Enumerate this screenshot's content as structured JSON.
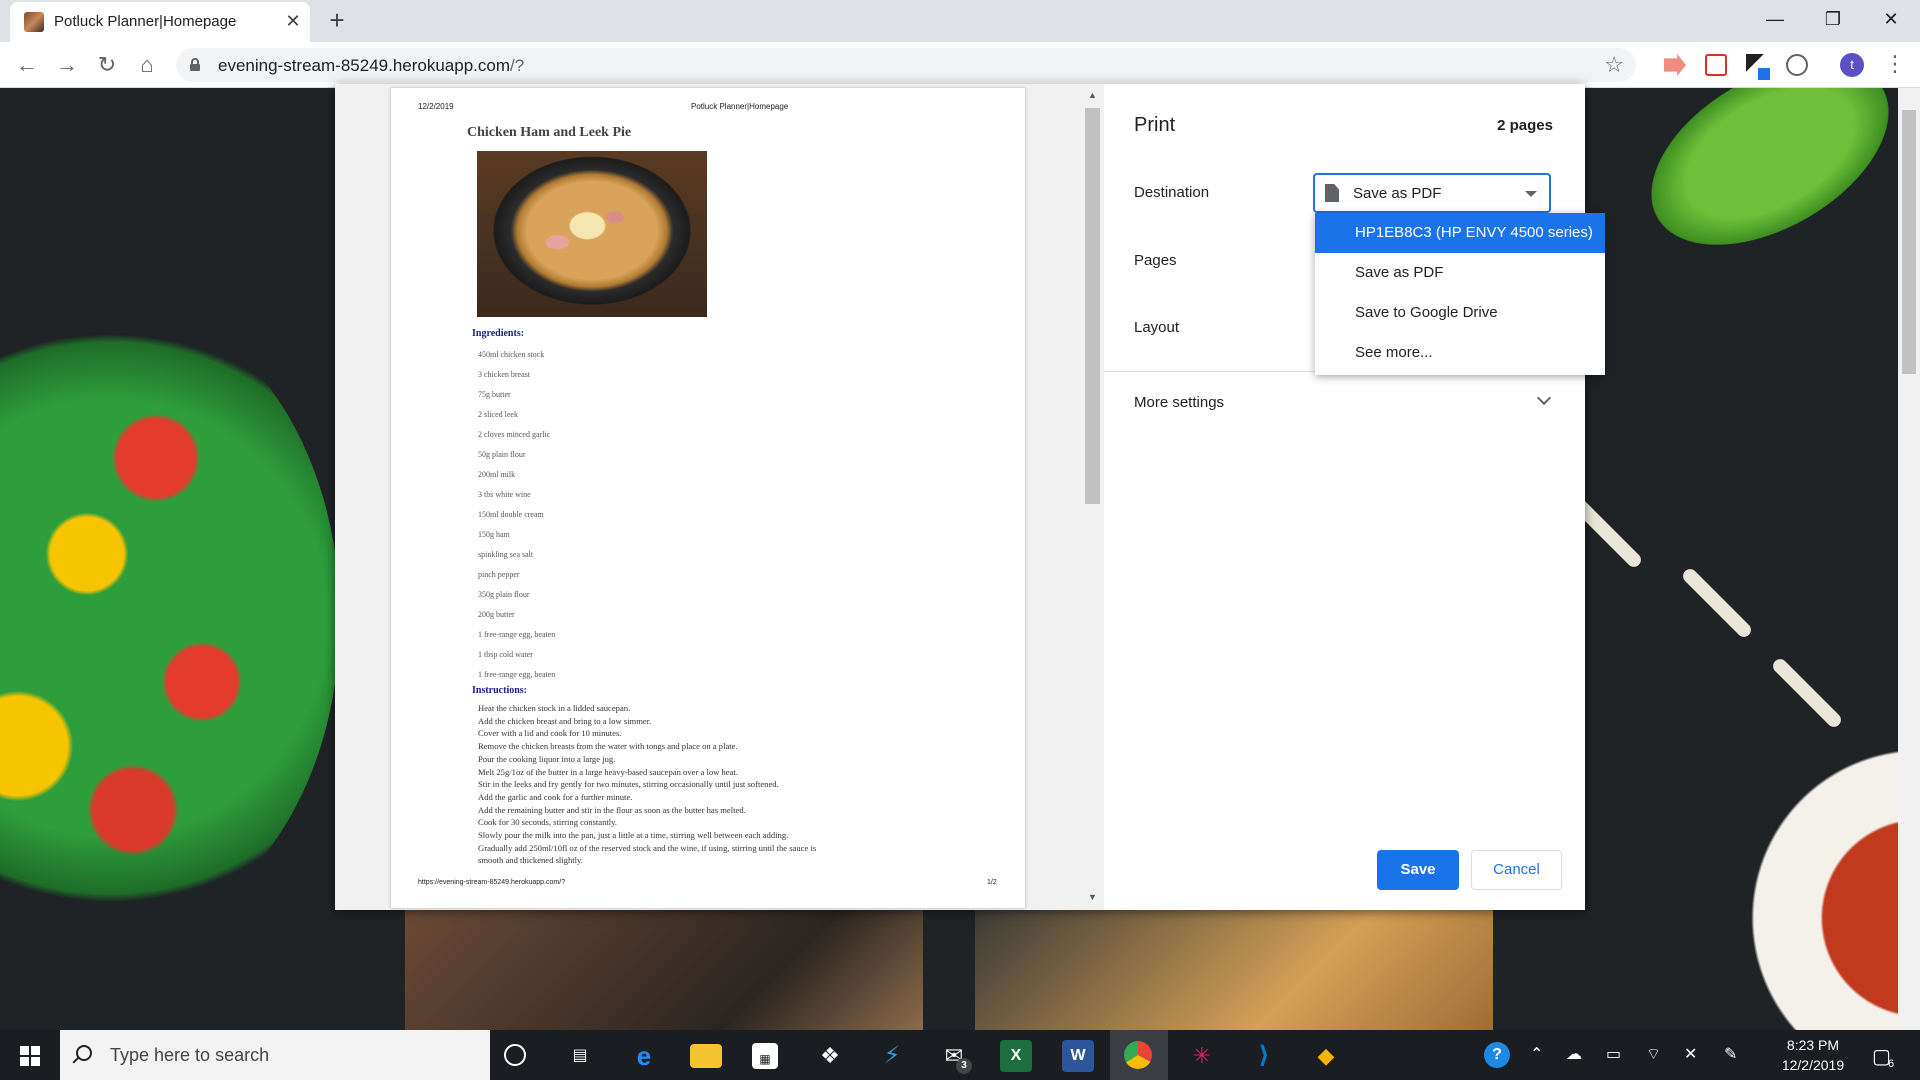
{
  "browser": {
    "tab_title": "Potluck Planner|Homepage",
    "tab_close": "✕",
    "new_tab": "+",
    "window_min": "—",
    "window_restore": "❐",
    "window_close": "✕",
    "back": "←",
    "forward": "→",
    "reload": "↻",
    "home": "⌂",
    "url_host": "evening-stream-85249.herokuapp.com",
    "url_path": "/?",
    "bookmark": "☆",
    "profile_initial": "t",
    "menu": "⋮"
  },
  "preview": {
    "header_date": "12/2/2019",
    "header_title": "Potluck Planner|Homepage",
    "recipe_title": "Chicken Ham and Leek Pie",
    "ingredients_heading": "Ingredients:",
    "ingredients": [
      "450ml chicken stock",
      "3 chicken breast",
      "75g butter",
      "2 sliced leek",
      "2 cloves minced garlic",
      "50g plain flour",
      "200ml milk",
      "3 tbs white wine",
      "150ml double cream",
      "150g ham",
      "spinkling sea salt",
      "pinch pepper",
      "350g plain flour",
      "200g butter",
      "1 free-range egg, beaten",
      "1 tbsp cold water",
      "1 free-range egg, beaten"
    ],
    "instructions_heading": "Instructions:",
    "instructions": [
      "Heat the chicken stock in a lidded saucepan.",
      "Add the chicken breast and bring to a low simmer.",
      "Cover with a lid and cook for 10 minutes.",
      "Remove the chicken breasts from the water with tongs and place on a plate.",
      "Pour the cooking liquor into a large jug.",
      "Melt 25g/1oz of the butter in a large heavy-based saucepan over a low heat.",
      "Stir in the leeks and fry gently for two minutes, stirring occasionally until just softened.",
      "Add the garlic and cook for a further minute.",
      "Add the remaining butter and stir in the flour as soon as the butter has melted.",
      "Cook for 30 seconds, stirring constantly.",
      "Slowly pour the milk into the pan, just a little at a time, stirring well between each adding.",
      "Gradually add 250ml/10fl oz of the reserved stock and the wine, if using, stirring until the sauce is",
      "smooth and thickened slightly."
    ],
    "footer_url": "https://evening-stream-85249.herokuapp.com/?",
    "footer_page": "1/2"
  },
  "print": {
    "title": "Print",
    "page_count": "2 pages",
    "destination_label": "Destination",
    "destination_value": "Save as PDF",
    "pages_label": "Pages",
    "layout_label": "Layout",
    "more_settings_label": "More settings",
    "dropdown_options": [
      "HP1EB8C3 (HP ENVY 4500 series)",
      "Save as PDF",
      "Save to Google Drive",
      "See more..."
    ],
    "dropdown_selected_index": 0,
    "save_label": "Save",
    "cancel_label": "Cancel"
  },
  "taskbar": {
    "search_placeholder": "Type here to search",
    "mail_badge": "3",
    "time": "8:23 PM",
    "date": "12/2/2019",
    "notification_count": "6"
  },
  "colors": {
    "accent": "#1a73e8",
    "heading_blue": "#1a237e"
  }
}
